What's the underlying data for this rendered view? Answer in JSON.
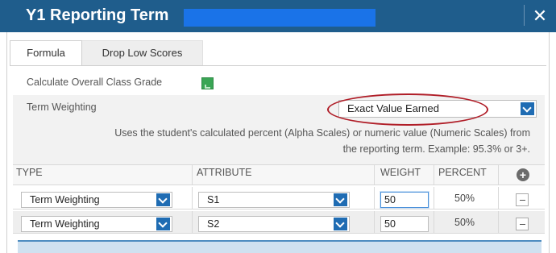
{
  "window": {
    "title": "Y1 Reporting Term",
    "close_glyph": "✕"
  },
  "tabs": [
    {
      "label": "Formula",
      "active": true
    },
    {
      "label": "Drop Low Scores",
      "active": false
    }
  ],
  "calculate_overall": {
    "label": "Calculate Overall Class Grade",
    "checked": true
  },
  "term_weighting": {
    "label": "Term Weighting",
    "selected": "Exact Value Earned",
    "description_line1": "Uses the student's calculated percent (Alpha Scales) or numeric value (Numeric Scales) from",
    "description_line2": "the reporting term. Example: 95.3% or 3+."
  },
  "grid": {
    "headers": {
      "type": "TYPE",
      "attribute": "ATTRIBUTE",
      "weight": "WEIGHT",
      "percent": "PERCENT"
    },
    "add_icon": "plus-circle-icon",
    "rows": [
      {
        "type": "Term Weighting",
        "attribute": "S1",
        "weight": "50",
        "percent": "50%"
      },
      {
        "type": "Term Weighting",
        "attribute": "S2",
        "weight": "50",
        "percent": "50%"
      }
    ]
  },
  "colors": {
    "titlebar": "#1f5d8c",
    "dropdown_accent": "#1f6cb3",
    "checkbox": "#3aa555",
    "annotation_ellipse": "#b01e28"
  }
}
